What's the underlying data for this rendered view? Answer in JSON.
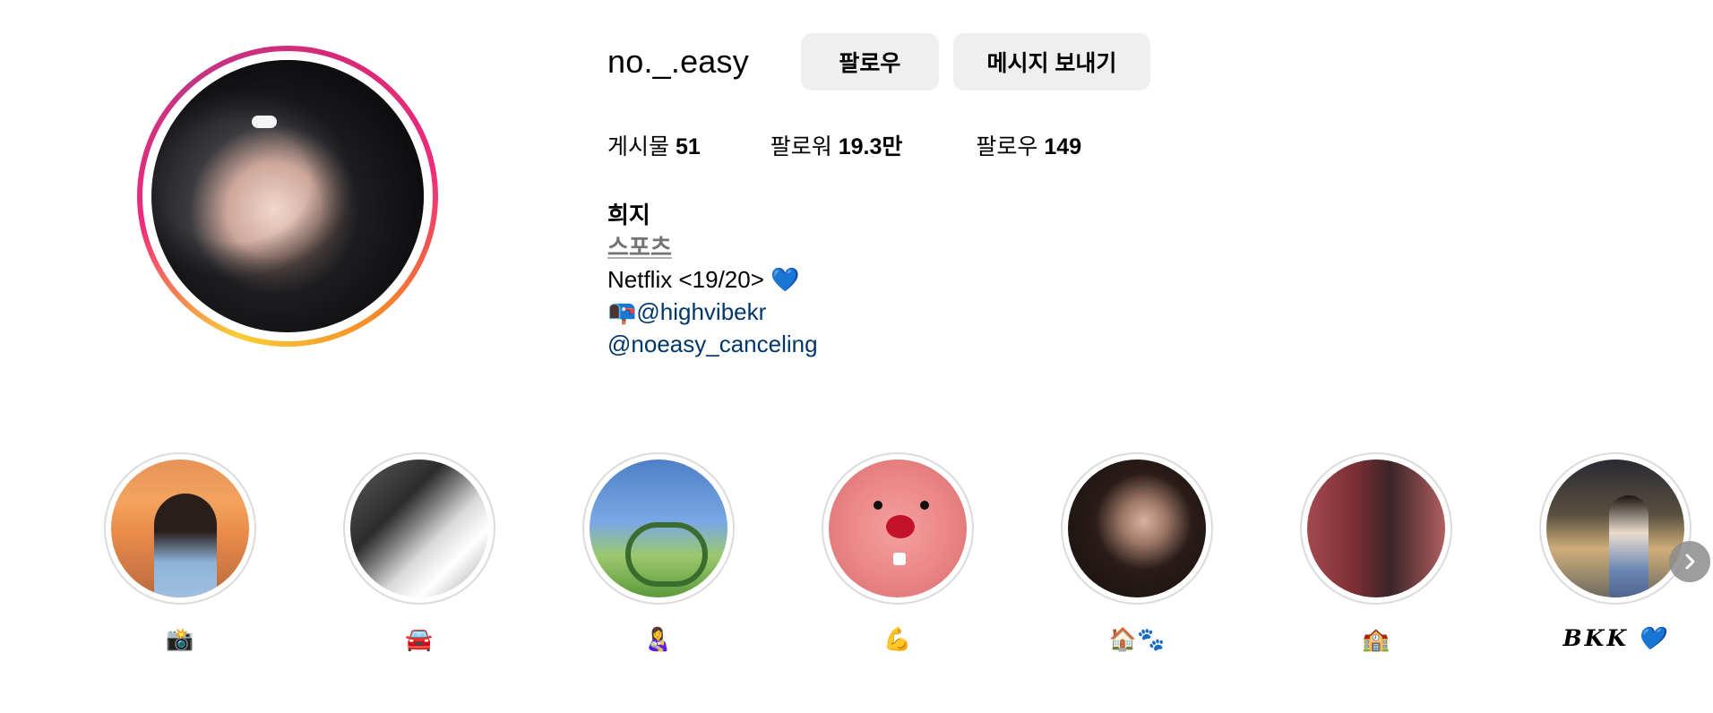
{
  "profile": {
    "username": "no._.easy",
    "follow_label": "팔로우",
    "message_label": "메시지 보내기",
    "stats": [
      {
        "label": "게시물",
        "value": "51"
      },
      {
        "label": "팔로워",
        "value": "19.3만"
      },
      {
        "label": "팔로우",
        "value": "149"
      }
    ],
    "bio": {
      "name": "희지",
      "category": "스포츠",
      "line1": "Netflix <19/20> 💙",
      "mail_icon": "📭",
      "link1": "@highvibekr",
      "link2": "@noeasy_canceling"
    }
  },
  "highlights": [
    {
      "label": "📸"
    },
    {
      "label": "🚘"
    },
    {
      "label": "👩‍🍼"
    },
    {
      "label": "💪"
    },
    {
      "label": "🏠🐾"
    },
    {
      "label": "🏫"
    },
    {
      "label": "𝑩𝑲𝑲 💙"
    }
  ],
  "icons": {
    "next": "chevron-right-icon"
  }
}
